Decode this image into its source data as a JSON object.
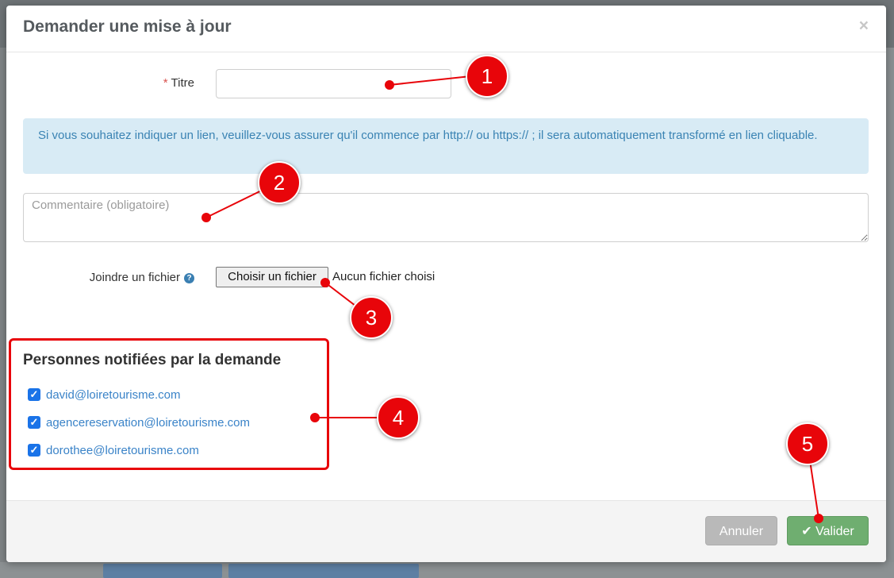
{
  "dialog": {
    "title": "Demander une mise à jour",
    "close_symbol": "×"
  },
  "form": {
    "title_label": "Titre",
    "required_mark": "*",
    "title_value": "",
    "info_text": "Si vous souhaitez indiquer un lien, veuillez-vous assurer qu'il commence par http:// ou https:// ; il sera automatiquement transformé en lien cliquable.",
    "comment_placeholder": "Commentaire (obligatoire)",
    "file_label": "Joindre un fichier",
    "help_icon": "question-circle-icon",
    "help_symbol": "?",
    "file_button_label": "Choisir un fichier",
    "file_status": "Aucun fichier choisi"
  },
  "notifications": {
    "heading": "Personnes notifiées par la demande",
    "recipients": [
      {
        "email": "david@loiretourisme.com",
        "checked": true
      },
      {
        "email": "agencereservation@loiretourisme.com",
        "checked": true
      },
      {
        "email": "dorothee@loiretourisme.com",
        "checked": true
      }
    ]
  },
  "footer": {
    "cancel_label": "Annuler",
    "validate_label": "Valider",
    "validate_icon": "check-icon"
  },
  "annotations": {
    "color": "#e8050a",
    "callouts": [
      "1",
      "2",
      "3",
      "4",
      "5"
    ]
  },
  "colors": {
    "info_bg": "#d8ebf5",
    "info_text": "#3a83b3",
    "validate_bg": "#6fae70",
    "cancel_bg": "#b9b9b9",
    "link": "#3a83c8"
  }
}
